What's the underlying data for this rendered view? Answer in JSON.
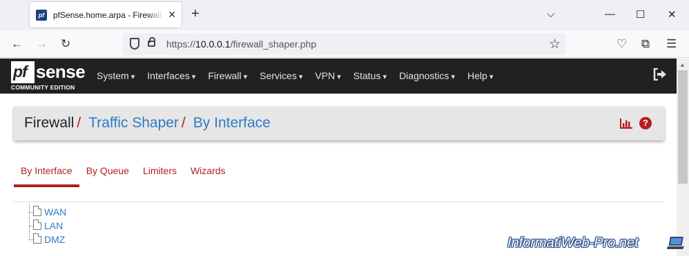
{
  "browser": {
    "tab_title": "pfSense.home.arpa - Firewall: Traffic Shaper",
    "favicon_text": "pf",
    "url_host": "10.0.0.1",
    "url_prefix": "https://",
    "url_path": "/firewall_shaper.php"
  },
  "pfsense": {
    "logo_pf": "pf",
    "logo_sense": "sense",
    "logo_edition": "COMMUNITY EDITION",
    "menu": [
      "System",
      "Interfaces",
      "Firewall",
      "Services",
      "VPN",
      "Status",
      "Diagnostics",
      "Help"
    ],
    "breadcrumb": {
      "root": "Firewall",
      "separator": "/",
      "items": [
        "Traffic Shaper",
        "By Interface"
      ]
    },
    "help_glyph": "?",
    "tabs": [
      {
        "label": "By Interface",
        "active": true
      },
      {
        "label": "By Queue",
        "active": false
      },
      {
        "label": "Limiters",
        "active": false
      },
      {
        "label": "Wizards",
        "active": false
      }
    ],
    "interfaces": [
      "WAN",
      "LAN",
      "DMZ"
    ]
  },
  "watermark": "InformatiWeb-Pro.net",
  "colors": {
    "header_bg": "#212121",
    "accent_red": "#b21e1e",
    "link_blue": "#2f79c6"
  },
  "icons": {
    "chart": "bar-chart-icon",
    "help": "question-circle-icon",
    "logout": "sign-out-icon"
  }
}
